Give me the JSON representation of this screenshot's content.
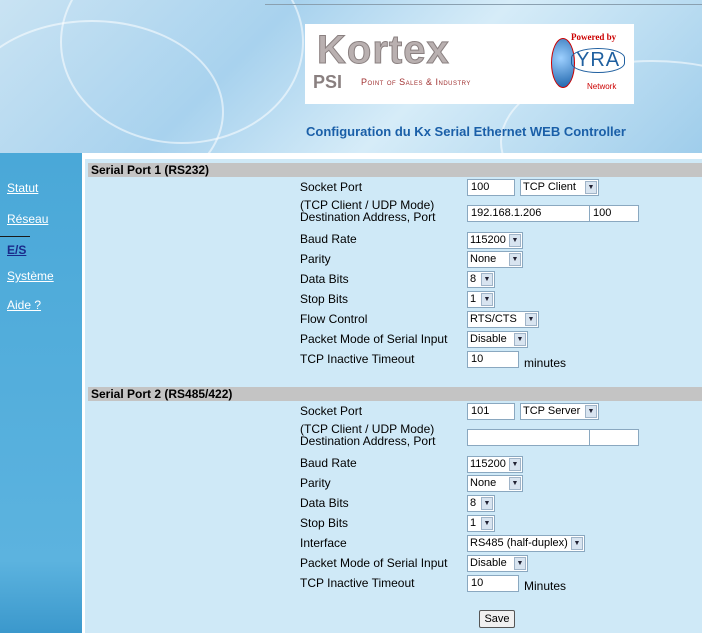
{
  "header": {
    "logo_main": "Kortex",
    "logo_sub": "PSI",
    "logo_tagline": "Point of Sales & Industry",
    "powered_by": "Powered by",
    "powered_brand": "YRA",
    "powered_network": "Network",
    "title": "Configuration du Kx Serial Ethernet WEB Controller"
  },
  "sidebar": {
    "items": [
      {
        "label": "Statut"
      },
      {
        "label": "Réseau"
      },
      {
        "label": "E/S"
      },
      {
        "label": "Système"
      },
      {
        "label": "Aide ?"
      }
    ]
  },
  "port1": {
    "title": "Serial Port 1 (RS232)",
    "socket_port_label": "Socket Port",
    "socket_port": "100",
    "socket_mode": "TCP Client",
    "dest_label_1": "(TCP Client / UDP  Mode)",
    "dest_label_2": "Destination Address, Port",
    "dest_address": "192.168.1.206",
    "dest_port": "100",
    "baud_label": "Baud Rate",
    "baud": "115200",
    "parity_label": "Parity",
    "parity": "None",
    "data_bits_label": "Data Bits",
    "data_bits": "8",
    "stop_bits_label": "Stop Bits",
    "stop_bits": "1",
    "flow_label": "Flow Control",
    "flow": "RTS/CTS",
    "packet_label": "Packet Mode of Serial Input",
    "packet": "Disable",
    "timeout_label": "TCP Inactive Timeout",
    "timeout": "10",
    "timeout_unit": "minutes"
  },
  "port2": {
    "title": "Serial Port 2 (RS485/422)",
    "socket_port_label": "Socket Port",
    "socket_port": "101",
    "socket_mode": "TCP Server",
    "dest_label_1": "(TCP Client / UDP Mode)",
    "dest_label_2": "Destination Address, Port",
    "dest_address": "",
    "dest_port": "",
    "baud_label": "Baud Rate",
    "baud": "115200",
    "parity_label": "Parity",
    "parity": "None",
    "data_bits_label": "Data Bits",
    "data_bits": "8",
    "stop_bits_label": "Stop Bits",
    "stop_bits": "1",
    "interface_label": "Interface",
    "interface": "RS485 (half-duplex)",
    "packet_label": "Packet Mode of Serial Input",
    "packet": "Disable",
    "timeout_label": "TCP Inactive Timeout",
    "timeout": "10",
    "timeout_unit": "Minutes"
  },
  "actions": {
    "save_label": "Save"
  },
  "colors": {
    "sidebar": "#4aa8d8",
    "content_bg": "#cfe9f7",
    "section_head": "#c4c4c4",
    "title_blue": "#1a5fa8"
  }
}
